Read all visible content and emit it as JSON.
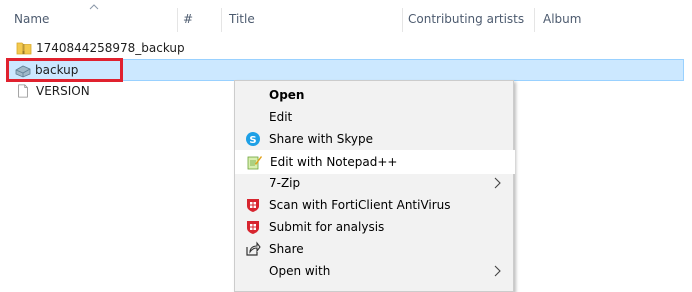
{
  "header": {
    "columns": [
      "Name",
      "#",
      "Title",
      "Contributing artists",
      "Album"
    ]
  },
  "files": [
    {
      "name": "1740844258978_backup",
      "icon": "folder-zip-icon"
    },
    {
      "name": "backup",
      "icon": "archive-file-icon",
      "selected": true
    },
    {
      "name": "VERSION",
      "icon": "blank-file-icon"
    }
  ],
  "context_menu": {
    "items": [
      {
        "label": "Open",
        "bold": true
      },
      {
        "label": "Edit"
      },
      {
        "label": "Share with Skype",
        "icon": "skype-icon"
      },
      {
        "label": "Edit with Notepad++",
        "icon": "notepad-plus-plus-icon",
        "hover": true
      },
      {
        "label": "7-Zip",
        "submenu": true
      },
      {
        "label": "Scan with FortiClient AntiVirus",
        "icon": "forticlient-icon"
      },
      {
        "label": "Submit for analysis",
        "icon": "forticlient-icon"
      },
      {
        "label": "Share",
        "icon": "share-icon"
      },
      {
        "label": "Open with",
        "submenu": true
      }
    ]
  },
  "colors": {
    "selection": "#cce8ff",
    "highlight_border": "#e0212e",
    "header_text": "#4d5b6f"
  }
}
